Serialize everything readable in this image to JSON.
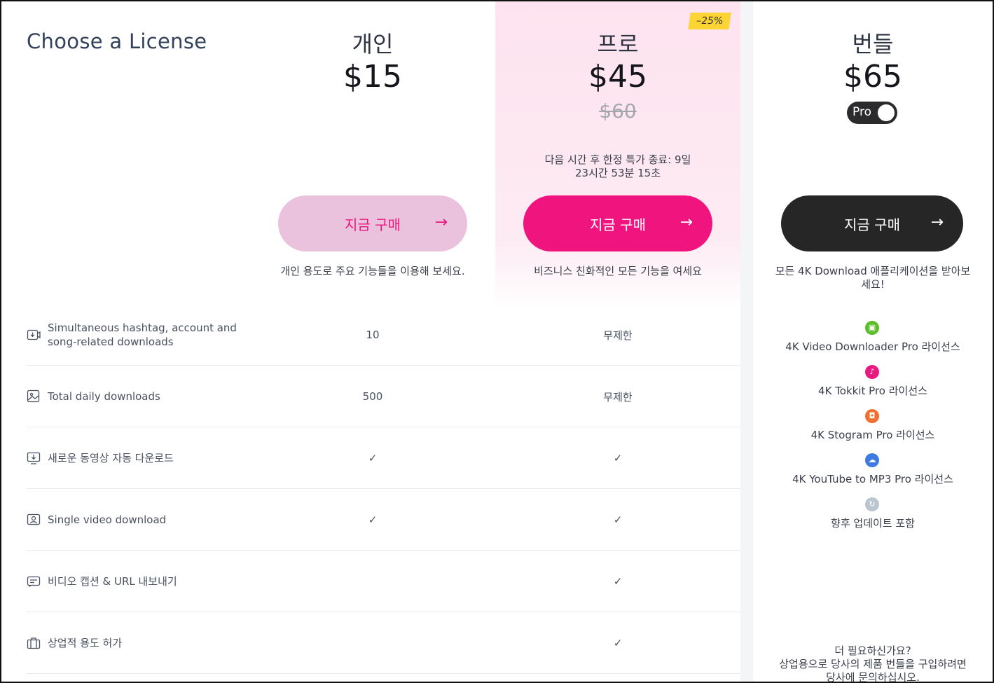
{
  "page_title": "Choose a License",
  "plans": {
    "personal": {
      "name": "개인",
      "price": "$15",
      "buy_label": "지금 구매",
      "description": "개인 용도로 주요 기능들을 이용해 보세요."
    },
    "pro": {
      "name": "프로",
      "price": "$45",
      "old_price": "$60",
      "discount": "–25%",
      "promo": "다음 시간 후 한정 특가 종료: 9일 23시간 53분 15초",
      "buy_label": "지금 구매",
      "description": "비즈니스 친화적인 모든 기능을 여세요"
    },
    "bundle": {
      "name": "번들",
      "price": "$65",
      "toggle_label": "Pro",
      "toggle_on": true,
      "buy_label": "지금 구매",
      "description": "모든 4K Download 애플리케이션을 받아보세요!",
      "items": [
        {
          "label": "4K Video Downloader Pro 라이선스",
          "icon": "video-downloader-icon",
          "color": "#5cbd2a"
        },
        {
          "label": "4K Tokkit Pro 라이선스",
          "icon": "tokkit-icon",
          "color": "#e8197f"
        },
        {
          "label": "4K Stogram Pro 라이선스",
          "icon": "stogram-icon",
          "color": "#f07030"
        },
        {
          "label": "4K YouTube to MP3 Pro 라이선스",
          "icon": "youtube-to-mp3-icon",
          "color": "#3d7be0"
        },
        {
          "label": "향후 업데이트 포함",
          "icon": "updates-icon",
          "color": "#b9c6d1"
        }
      ],
      "more_title": "더 필요하신가요?",
      "more_text": "상업용으로 당사의 제품 번들을 구입하려면 당사에 문의하십시오."
    }
  },
  "features": [
    {
      "label": "Simultaneous hashtag, account and song-related downloads",
      "icon": "download-hashtag-icon",
      "personal": "10",
      "pro": "무제한"
    },
    {
      "label": "Total daily downloads",
      "icon": "image-download-icon",
      "personal": "500",
      "pro": "무제한"
    },
    {
      "label": "새로운 동영상 자동 다운로드",
      "icon": "monitor-download-icon",
      "personal": "✓",
      "pro": "✓"
    },
    {
      "label": "Single video download",
      "icon": "profile-icon",
      "personal": "✓",
      "pro": "✓"
    },
    {
      "label": "비디오 캡션 & URL 내보내기",
      "icon": "caption-icon",
      "personal": "",
      "pro": "✓"
    },
    {
      "label": "상업적 용도 허가",
      "icon": "briefcase-icon",
      "personal": "",
      "pro": "✓"
    }
  ],
  "colors": {
    "accent": "#f0147f",
    "personal_button": "#ebc2dd",
    "bundle_button": "#262626",
    "discount_badge": "#fcd535"
  },
  "arrow_glyph": "→"
}
